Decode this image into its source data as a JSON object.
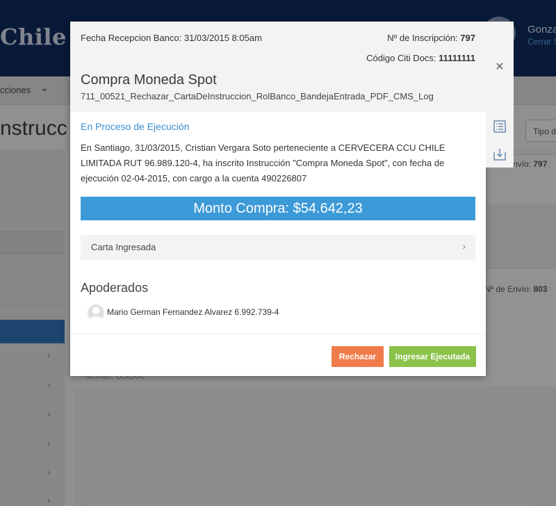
{
  "app": {
    "brand": "Chile",
    "user_name": "Gonza",
    "logout_label": "Cerrar S",
    "subnav_item": "cciones",
    "page_title": "nstrucc",
    "type_button": "Tipo d",
    "bg_envio_1_label": "nvío:",
    "bg_envio_1_value": "797",
    "bg_envio_2_label": "Nº de Envío:",
    "bg_envio_2_value": "803",
    "bg_monto": "Monto: USD00"
  },
  "modal": {
    "fecha": "Fecha Recepcion Banco: 31/03/2015 8:05am",
    "inscripcion_label": "Nº de Inscripción:",
    "inscripcion_value": "797",
    "citi_label": "Código Citi Docs:",
    "citi_value": "11111111",
    "title": "Compra Moneda Spot",
    "subtitle": "711_00521_Rechazar_CartaDeInstruccion_RolBanco_BandejaEntrada_PDF_CMS_Log",
    "status": "En Proceso de Ejecución",
    "description": "En Santiago, 31/03/2015, Cristian Vergara Soto perteneciente a CERVECERA CCU CHILE LIMITADA RUT 96.989.120-4, ha inscrito Instrucción \"Compra Moneda Spot\", con fecha de ejecución 02-04-2015, con cargo a la cuenta 490226807",
    "amount": "Monto Compra: $54.642,23",
    "letter_label": "Carta Ingresada",
    "apoderados_heading": "Apoderados",
    "apoderado_name": "Mario German Fernandez Alvarez 6.992.739-4",
    "reject_label": "Rechazar",
    "execute_label": "Ingresar Ejecutada"
  },
  "icons": {
    "close": "close-icon",
    "list": "list-icon",
    "download": "download-icon",
    "chevron": "chevron-right-icon"
  },
  "colors": {
    "topbar": "#0f2a5c",
    "status": "#3a8fd0",
    "amount_bar": "#3d9ad8",
    "reject": "#f07c4b",
    "execute": "#8bc34a"
  }
}
